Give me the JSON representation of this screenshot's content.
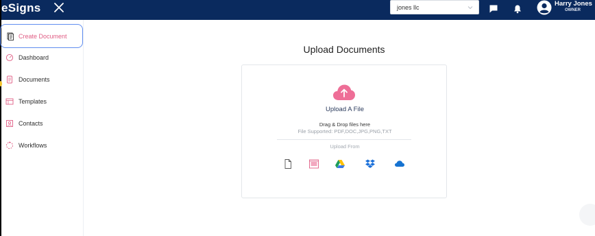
{
  "app": {
    "logo": "eSigns"
  },
  "header": {
    "org_select_value": "jones llc",
    "user_name": "Harry Jones",
    "user_role": "OWNER"
  },
  "sidebar": {
    "items": [
      {
        "label": "Create Document",
        "icon": "create-document-icon",
        "active": true
      },
      {
        "label": "Dashboard",
        "icon": "dashboard-icon"
      },
      {
        "label": "Documents",
        "icon": "documents-icon"
      },
      {
        "label": "Templates",
        "icon": "templates-icon"
      },
      {
        "label": "Contacts",
        "icon": "contacts-icon"
      },
      {
        "label": "Workflows",
        "icon": "workflows-icon"
      }
    ]
  },
  "main": {
    "title": "Upload Documents",
    "upload": {
      "title": "Upload A File",
      "drag_text": "Drag & Drop files here",
      "supported": "File Supported: PDF,DOC,JPG,PNG,TXT",
      "upload_from": "Upload From",
      "sources": [
        "blank-file-icon",
        "template-icon",
        "google-drive-icon",
        "dropbox-icon",
        "onedrive-icon"
      ]
    }
  },
  "colors": {
    "topbar": "#0a2a5e",
    "accent_pink": "#e05d84",
    "active_border": "#5f8df0"
  }
}
